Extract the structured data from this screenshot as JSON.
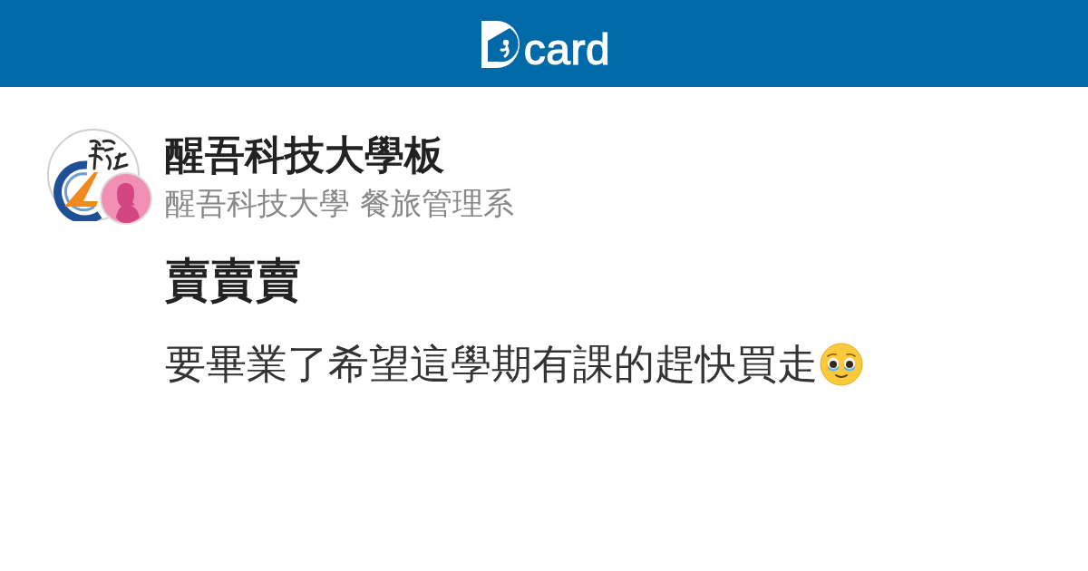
{
  "header": {
    "logo_text": "card"
  },
  "board": {
    "name": "醒吾科技大學板"
  },
  "author": {
    "info": "醒吾科技大學 餐旅管理系"
  },
  "post": {
    "title": "賣賣賣",
    "body": "要畢業了希望這學期有課的趕快買走"
  }
}
